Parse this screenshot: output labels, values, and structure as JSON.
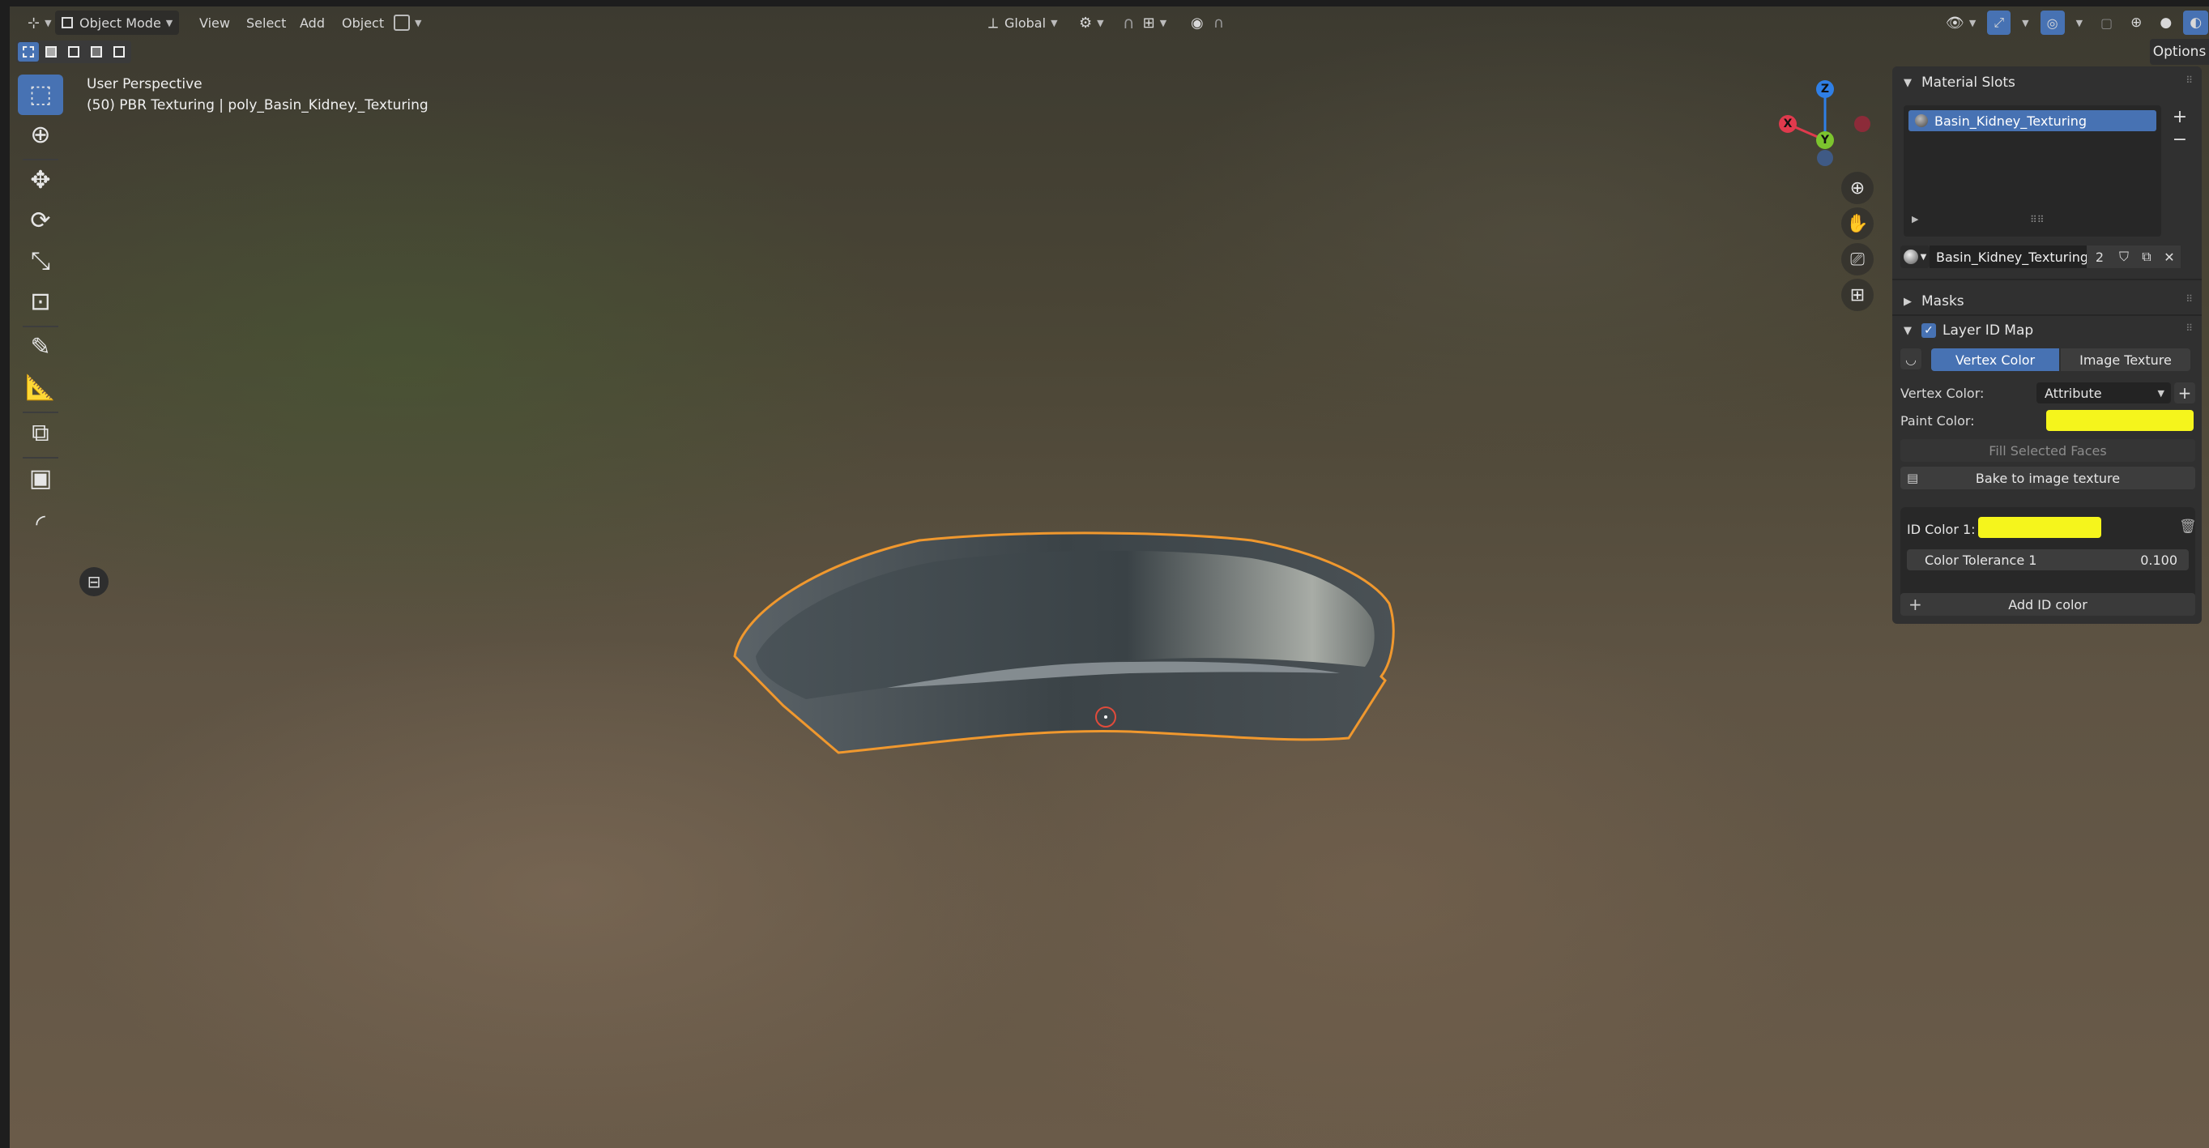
{
  "header": {
    "mode": "Object Mode",
    "menus": [
      "View",
      "Select",
      "Add",
      "Object"
    ],
    "orientation": "Global"
  },
  "toolbar": {
    "tools": [
      "select-box",
      "cursor",
      "move",
      "rotate",
      "scale",
      "transform",
      "annotate",
      "measure",
      "add-cube",
      "bake-tool",
      "curve-tool"
    ]
  },
  "viewport": {
    "perspective": "User Perspective",
    "object_info": "(50) PBR Texturing | poly_Basin_Kidney._Texturing",
    "options_label": "Options",
    "gizmo": {
      "x": "X",
      "y": "Y",
      "z": "Z"
    }
  },
  "panel": {
    "material_slots": {
      "title": "Material Slots",
      "items": [
        "Basin_Kidney_Texturing"
      ],
      "material_name": "Basin_Kidney_Texturing",
      "users": "2"
    },
    "masks": {
      "title": "Masks"
    },
    "layer_id_map": {
      "title": "Layer ID Map",
      "tab_vertex": "Vertex Color",
      "tab_image": "Image Texture",
      "vertex_color_label": "Vertex Color:",
      "vertex_color_value": "Attribute",
      "paint_color_label": "Paint Color:",
      "fill_selected": "Fill Selected Faces",
      "bake": "Bake to image texture",
      "id_color_label": "ID Color 1:",
      "tolerance_label": "Color Tolerance 1",
      "tolerance_value": "0.100",
      "add_id": "Add ID color"
    }
  },
  "colors": {
    "accent": "#4772b3",
    "paint_color": "#f5f51c",
    "id_color": "#f5f51c",
    "selection_outline": "#f0982e"
  }
}
